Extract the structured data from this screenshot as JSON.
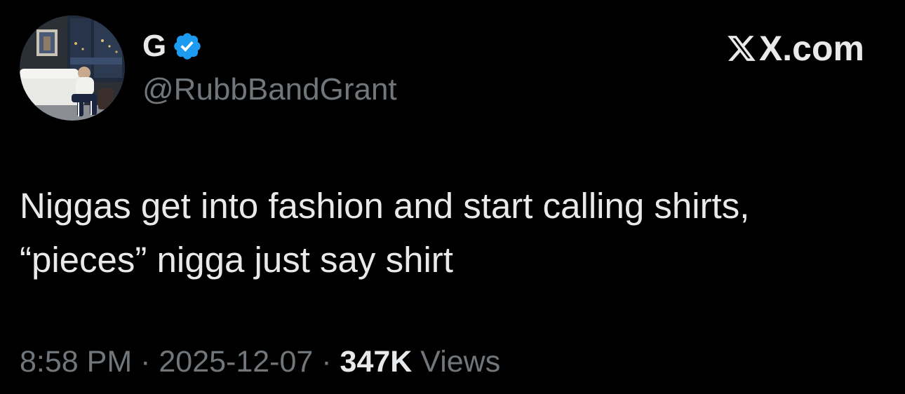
{
  "author": {
    "display_name": "G",
    "handle": "@RubbBandGrant",
    "verified": true,
    "verified_icon": "verified-badge-icon",
    "avatar_icon": "avatar-photo"
  },
  "brand": {
    "icon": "x-logo-icon",
    "label": "X.com"
  },
  "tweet": {
    "text": "Niggas get into fashion and start calling shirts,\n“pieces” nigga just say shirt"
  },
  "meta": {
    "time": "8:58 PM",
    "separator": " · ",
    "date": "2025-12-07",
    "views_count": "347K",
    "views_label": " Views"
  },
  "colors": {
    "background": "#000000",
    "primary_text": "#e7e9ea",
    "secondary_text": "#71767b",
    "verified_blue": "#1d9bf0"
  }
}
